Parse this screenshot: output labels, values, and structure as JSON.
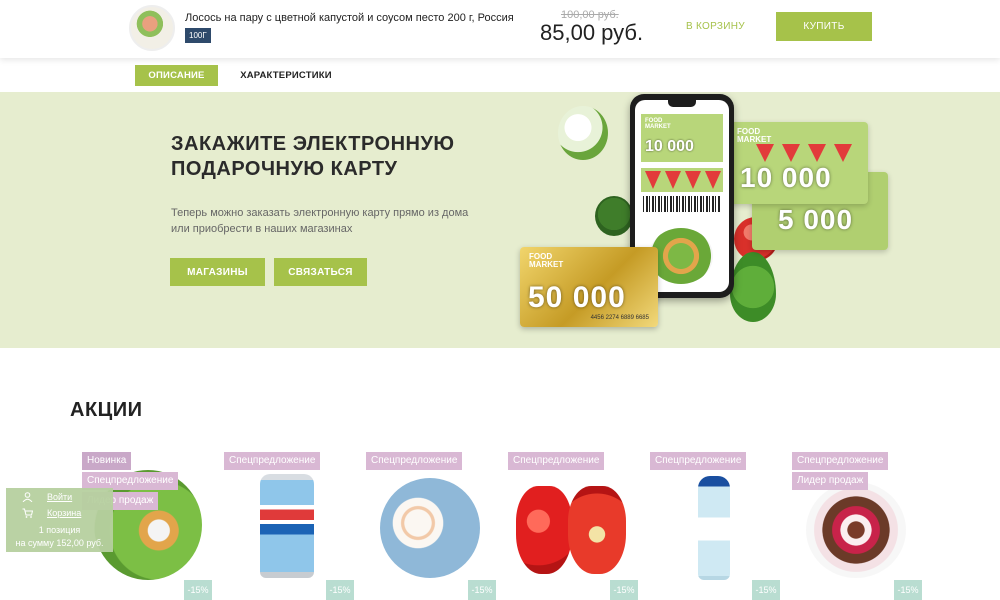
{
  "product_bar": {
    "title": "Лосось на пару с цветной капустой и соусом песто 200 г, Россия",
    "weight": "100Г",
    "old_price": "100,00 руб.",
    "price": "85,00 руб.",
    "to_cart": "В КОРЗИНУ",
    "buy": "КУПИТЬ"
  },
  "tabs": [
    {
      "label": "ОПИСАНИЕ",
      "active": true
    },
    {
      "label": "ХАРАКТЕРИСТИКИ",
      "active": false
    }
  ],
  "banner": {
    "title_line1": "ЗАКАЖИТЕ ЭЛЕКТРОННУЮ",
    "title_line2": "ПОДАРОЧНУЮ КАРТУ",
    "text_line1": "Теперь можно заказать электронную карту прямо из дома",
    "text_line2": "или приобрести в наших магазинах",
    "btn_shops": "МАГАЗИНЫ",
    "btn_contact": "СВЯЗАТЬСЯ",
    "card_brand_line1": "FOOD",
    "card_brand_line2": "MARKET",
    "card_gold_amount": "50 000",
    "card_gold_number": "4456 2274 6889 6685",
    "card_green_amount_1": "10 000",
    "card_green_amount_2": "5 000",
    "phone_card_amount": "10 000"
  },
  "promotions": {
    "title": "АКЦИИ",
    "items": [
      {
        "badges": [
          "Новинка",
          "Спецпредложение",
          "Лидер продаж"
        ],
        "discount": "-15%",
        "image": "salad-bowl"
      },
      {
        "badges": [
          "Спецпредложение"
        ],
        "discount": "-15%",
        "image": "pepsi-can"
      },
      {
        "badges": [
          "Спецпредложение"
        ],
        "discount": "-15%",
        "image": "marshmallow-plate"
      },
      {
        "badges": [
          "Спецпредложение"
        ],
        "discount": "-15%",
        "image": "red-peppers"
      },
      {
        "badges": [
          "Спецпредложение"
        ],
        "discount": "-15%",
        "image": "water-bottle"
      },
      {
        "badges": [
          "Спецпредложение",
          "Лидер продаж"
        ],
        "discount": "-15%",
        "image": "dessert-plate"
      }
    ]
  },
  "user_widget": {
    "login": "Войти",
    "cart": "Корзина",
    "count": "1 позиция",
    "sum": "на сумму 152,00 руб."
  },
  "colors": {
    "accent_green": "#a6c24a",
    "banner_bg": "#e6edcf",
    "badge": "#d9b8d4",
    "discount": "#b9ddd1"
  }
}
